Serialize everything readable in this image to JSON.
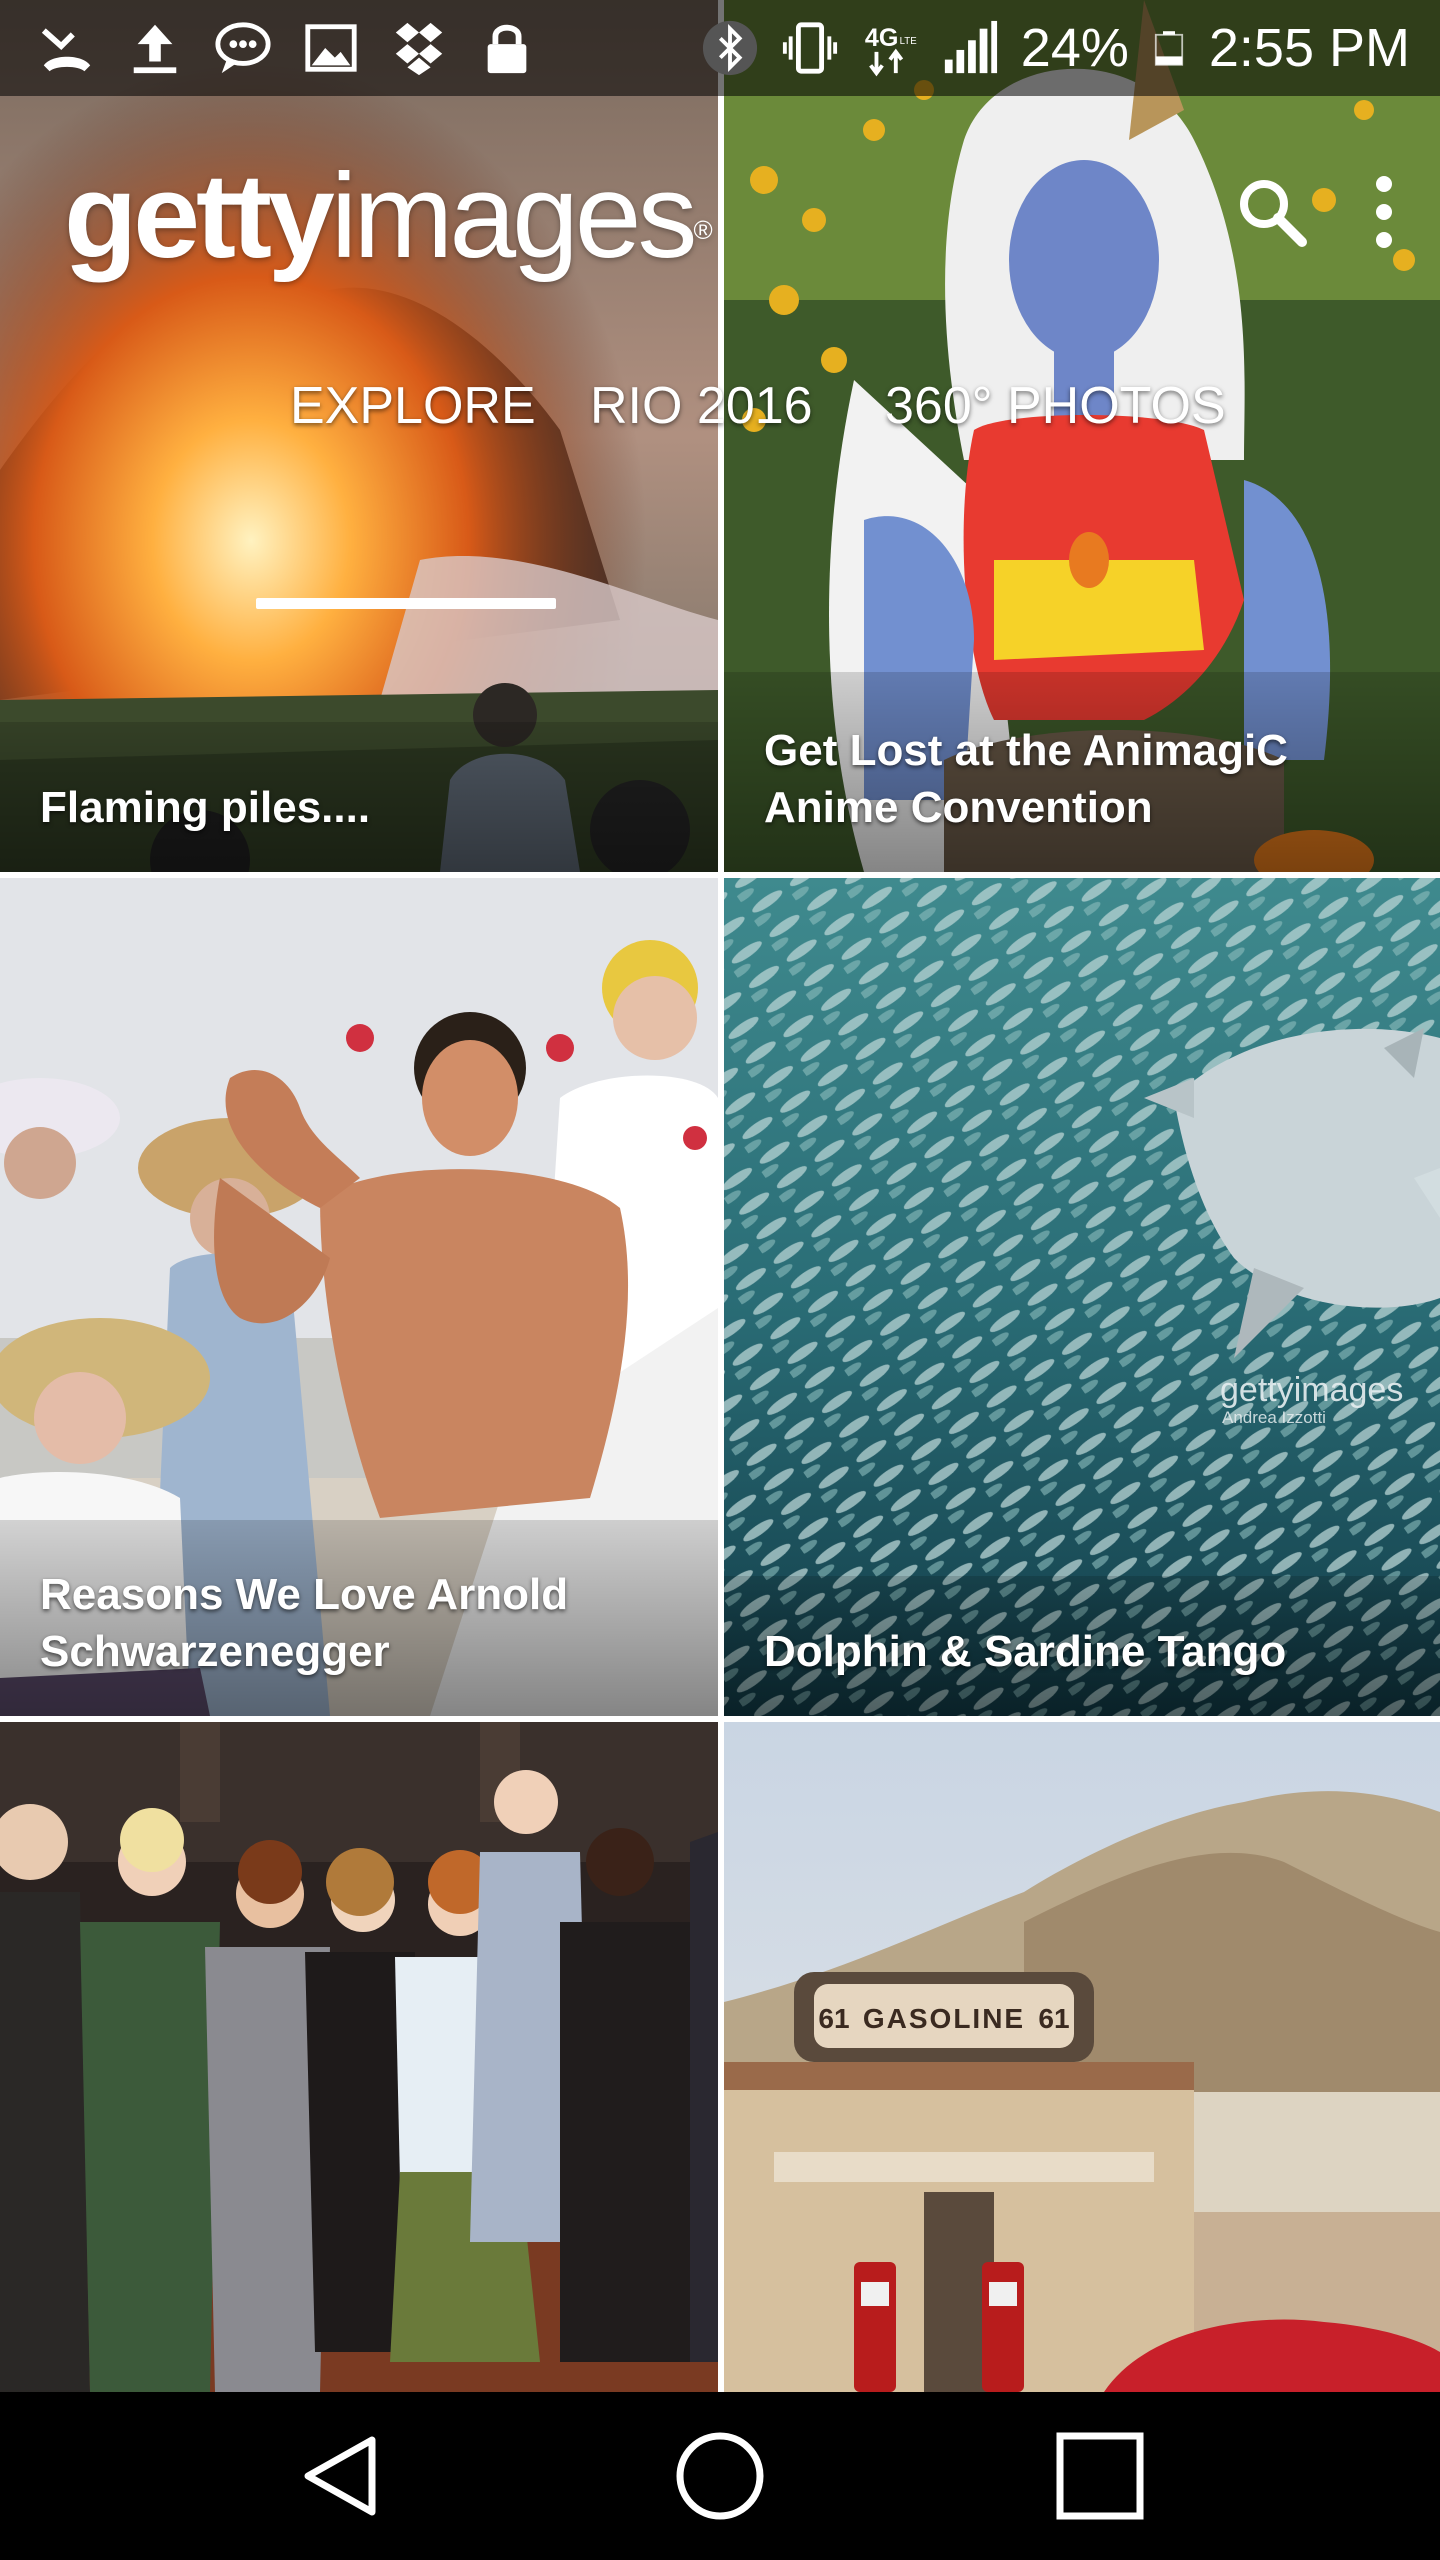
{
  "status_bar": {
    "left_icons": [
      "missed-call-icon",
      "upload-icon",
      "chat-icon",
      "image-icon",
      "dropbox-icon",
      "lock-icon"
    ],
    "right_icons": [
      "bluetooth-icon",
      "vibrate-icon",
      "lte-icon",
      "signal-icon",
      "battery-icon"
    ],
    "network": "4G",
    "network_sub": "LTE",
    "battery": "24%",
    "time": "2:55 PM"
  },
  "header": {
    "logo_bold": "getty",
    "logo_regular": "images",
    "logo_reg_mark": "®",
    "icons": [
      "search-icon",
      "more-vert-icon"
    ]
  },
  "tabs": [
    {
      "label": "EXPLORE",
      "selected": true
    },
    {
      "label": "RIO 2016",
      "selected": false
    },
    {
      "label": "360° PHOTOS",
      "selected": false
    }
  ],
  "tiles": [
    {
      "caption": "Flaming piles...."
    },
    {
      "caption": "Get Lost at the AnimagiC Anime Convention"
    },
    {
      "caption": "Reasons We Love Arnold Schwarzenegger"
    },
    {
      "caption": "Dolphin & Sardine Tango",
      "watermark": "gettyimages",
      "watermark_credit": "Andrea Izzotti"
    },
    {
      "caption": ""
    },
    {
      "caption": "",
      "sign_text": "GASOLINE",
      "sign_number": "61"
    }
  ],
  "nav_bar": {
    "icons": [
      "back-icon",
      "home-icon",
      "recent-apps-icon"
    ]
  },
  "colors": {
    "status_bar_bg": "#000000",
    "nav_bar_bg": "#000000",
    "text": "#ffffff",
    "tab_indicator": "#ffffff"
  }
}
